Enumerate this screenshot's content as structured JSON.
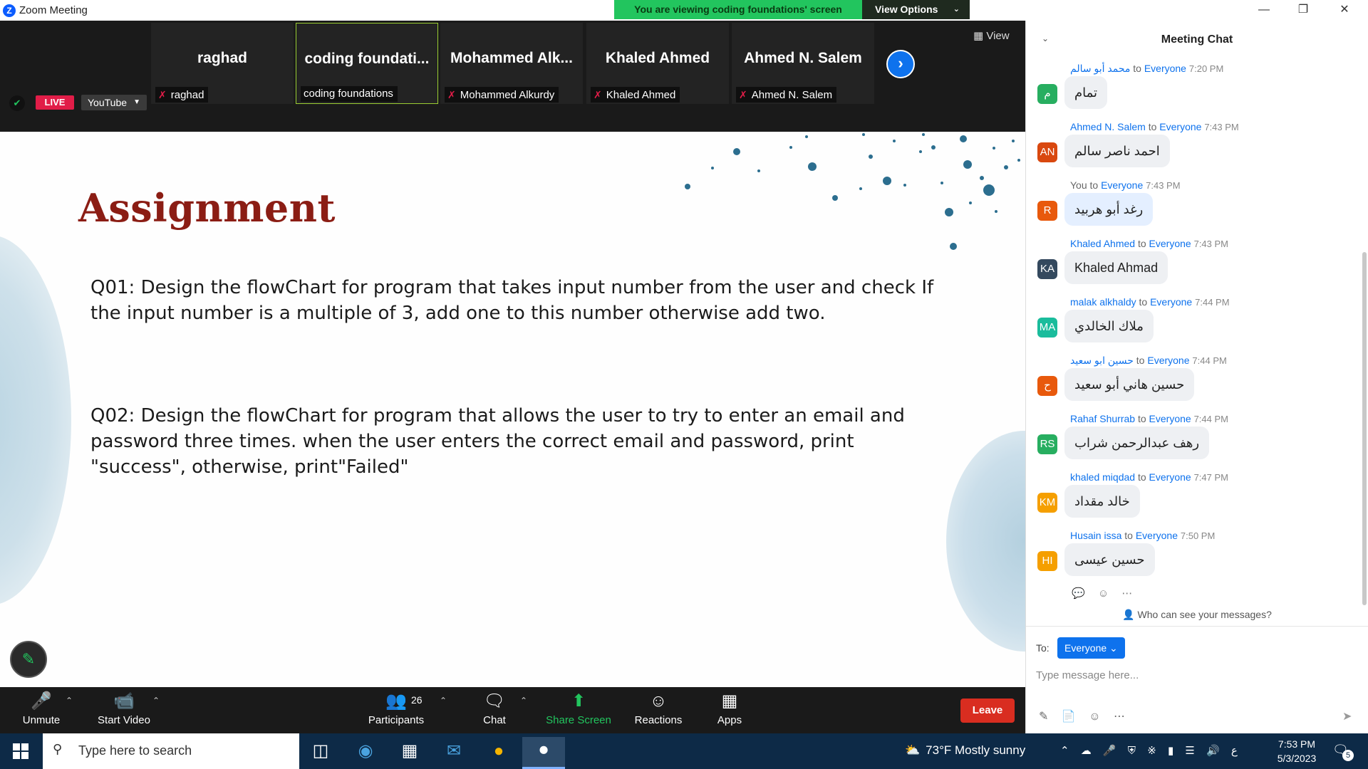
{
  "window": {
    "title": "Zoom Meeting",
    "logo_glyph": "Z",
    "banner": "You are viewing coding foundations' screen",
    "view_options": "View Options"
  },
  "gallery": {
    "view_label": "View",
    "live": "LIVE",
    "youtube": "YouTube",
    "tiles": [
      {
        "big": "raghad",
        "small": "raghad",
        "muted": true
      },
      {
        "big": "coding  foundati...",
        "small": "coding foundations",
        "muted": false
      },
      {
        "big": "Mohammed  Alk...",
        "small": "Mohammed Alkurdy",
        "muted": true
      },
      {
        "big": "Khaled Ahmed",
        "small": "Khaled Ahmed",
        "muted": true
      },
      {
        "big": "Ahmed N. Salem",
        "small": "Ahmed N. Salem",
        "muted": true
      }
    ]
  },
  "slide": {
    "title": "Assignment",
    "q1": "Q01: Design the flowChart for program that takes input number from the user and check If the input number is a multiple of 3, add one to this number otherwise add two.",
    "q2": "Q02: Design the flowChart for program that allows the user to try to enter an email and password three times. when the user enters the correct email and password, print \"success\", otherwise, print\"Failed\""
  },
  "toolbar": {
    "unmute": "Unmute",
    "start_video": "Start Video",
    "participants": "Participants",
    "participants_count": "26",
    "chat": "Chat",
    "share_screen": "Share Screen",
    "reactions": "Reactions",
    "apps": "Apps",
    "leave": "Leave"
  },
  "chat": {
    "title": "Meeting Chat",
    "to_word": "to",
    "messages": [
      {
        "sender": "محمد أبو سالم",
        "to": "Everyone",
        "time": "7:20 PM",
        "text": "تمام",
        "initials": "م",
        "color": "#27ae60"
      },
      {
        "sender": "Ahmed N. Salem",
        "to": "Everyone",
        "time": "7:43 PM",
        "text": "احمد ناصر سالم",
        "initials": "AN",
        "color": "#d9480f"
      },
      {
        "sender": "You",
        "to": "Everyone",
        "time": "7:43 PM",
        "text": "رغد أبو هربيد",
        "initials": "R",
        "color": "#e8590c"
      },
      {
        "sender": "Khaled Ahmed",
        "to": "Everyone",
        "time": "7:43 PM",
        "text": "Khaled Ahmad",
        "initials": "KA",
        "color": "#34495e"
      },
      {
        "sender": "malak alkhaldy",
        "to": "Everyone",
        "time": "7:44 PM",
        "text": "ملاك الخالدي",
        "initials": "MA",
        "color": "#1abc9c"
      },
      {
        "sender": "حسين ابو سعيد",
        "to": "Everyone",
        "time": "7:44 PM",
        "text": "حسين هاني أبو سعيد",
        "initials": "ح",
        "color": "#e8590c"
      },
      {
        "sender": "Rahaf Shurrab",
        "to": "Everyone",
        "time": "7:44 PM",
        "text": "رهف عبدالرحمن شراب",
        "initials": "RS",
        "color": "#27ae60"
      },
      {
        "sender": "khaled miqdad",
        "to": "Everyone",
        "time": "7:47 PM",
        "text": "خالد مقداد",
        "initials": "KM",
        "color": "#f59f00"
      },
      {
        "sender": "Husain issa",
        "to": "Everyone",
        "time": "7:50 PM",
        "text": "حسين عيسى",
        "initials": "HI",
        "color": "#f59f00"
      }
    ],
    "who_can_see": "Who can see your messages?",
    "to_label": "To:",
    "to_value": "Everyone",
    "input_placeholder": "Type message here..."
  },
  "taskbar": {
    "search_placeholder": "Type here to search",
    "weather": "73°F  Mostly sunny",
    "language": "ع",
    "time": "7:53 PM",
    "date": "5/3/2023",
    "notifications": "5"
  },
  "colors": {
    "zoom_blue": "#0e72ed",
    "banner_green": "#22c55e",
    "leave_red": "#d92d20",
    "title_red": "#8b1d14"
  }
}
